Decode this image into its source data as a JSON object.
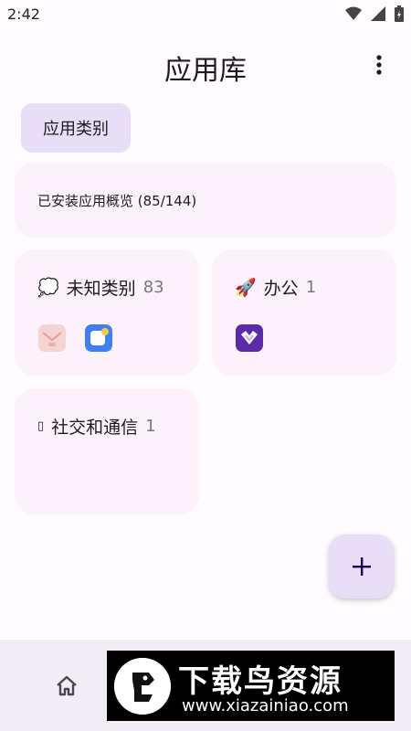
{
  "status_bar": {
    "time": "2:42",
    "icons": [
      "wifi-icon",
      "signal-icon",
      "battery-icon"
    ]
  },
  "header": {
    "title": "应用库",
    "menu_icon": "more-vert-icon"
  },
  "category_chip": {
    "label": "应用类别"
  },
  "overview": {
    "text": "已安装应用概览 (85/144)"
  },
  "categories": [
    {
      "emoji": "💭",
      "name": "未知类别",
      "count": "83",
      "app_icons": [
        "pink-envelope-app-icon",
        "blue-app-icon"
      ]
    },
    {
      "emoji": "🚀",
      "name": "办公",
      "count": "1",
      "app_icons": [
        "purple-heart-app-icon"
      ]
    },
    {
      "emoji": "▯",
      "name": "社交和通信",
      "count": "1",
      "app_icons": []
    }
  ],
  "fab": {
    "icon": "plus-icon"
  },
  "bottom_nav": {
    "home_icon": "home-icon"
  },
  "watermark": {
    "title": "下载鸟资源",
    "url": "www.xiazainiao.com"
  },
  "colors": {
    "chip_background": "#e8def8",
    "card_background": "#fdf1fb",
    "nav_background": "#f2ecf4",
    "fab_icon": "#21005d",
    "count_text": "#79747e"
  }
}
